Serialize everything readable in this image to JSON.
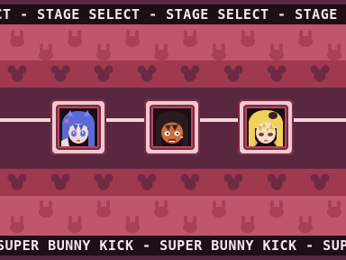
{
  "top_marquee": {
    "text": "ECT - STAGE SELECT - STAGE SELECT - STAGE SELECT"
  },
  "bottom_marquee": {
    "text": "SUPER BUNNY KICK - SUPER BUNNY KICK - SUPER"
  },
  "stages": [
    {
      "name": "stage-1",
      "character": "blue-haired-girl",
      "hair_color": "#5a6bd8"
    },
    {
      "name": "stage-2",
      "character": "dark-haired-girl",
      "hair_color": "#2a1a1c"
    },
    {
      "name": "stage-3",
      "character": "blonde-girl",
      "hair_color": "#f0d25a"
    }
  ],
  "background_icons": {
    "light_band": "bunny-icon",
    "dark_band": "mouse-ears-icon"
  },
  "colors": {
    "marquee_bg": "#1f0d18",
    "marquee_text": "#f4e6ec",
    "band_light": "#c0566b",
    "band_dark": "#9e3950",
    "band_deep": "#5a2740",
    "rail": "#f3d3dc"
  }
}
